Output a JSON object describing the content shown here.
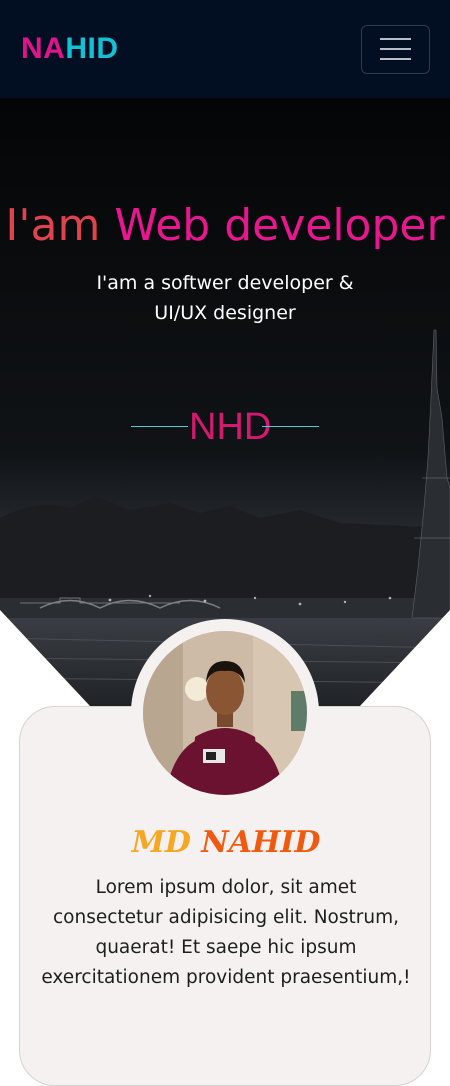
{
  "navbar": {
    "brand_part1": "NA",
    "brand_part2": "HID",
    "menu_icon": "hamburger-icon"
  },
  "hero": {
    "title_prefix": "I'am",
    "title_rest": "Web developer",
    "subtitle": "I'am a softwer developer & UI/UX designer",
    "logo_text": "NHD",
    "background": "night-city-eiffel-tower-photo"
  },
  "profile": {
    "avatar": "profile-photo",
    "name_first": "MD",
    "name_last": "NAHID",
    "description": "Lorem ipsum dolor, sit amet consectetur adipisicing elit. Nostrum, quaerat! Et saepe hic ipsum exercitationem provident praesentium,!"
  },
  "colors": {
    "navbar_bg": "#020f22",
    "brand_pink": "#e0148a",
    "brand_cyan": "#14c0d4",
    "card_bg": "#f5f1f0",
    "name_yellow": "#f5a623",
    "name_orange": "#f05a10"
  }
}
